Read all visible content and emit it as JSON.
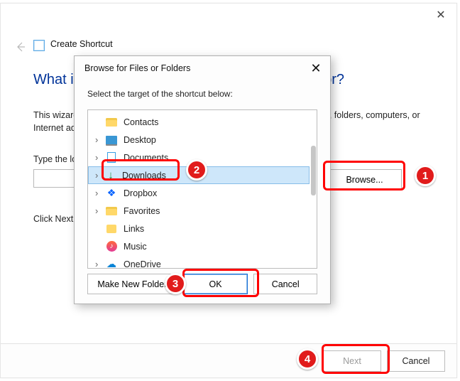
{
  "wizard": {
    "title": "Create Shortcut",
    "heading": "What item would you like to create a shortcut for?",
    "description": "This wizard helps you to create shortcuts to local or network programs, files, folders, computers, or Internet addresses.",
    "location_label": "Type the location of the item:",
    "browse_label": "Browse...",
    "continue_label": "Click Next to continue.",
    "next_label": "Next",
    "cancel_label": "Cancel"
  },
  "dialog": {
    "title": "Browse for Files or Folders",
    "instruction": "Select the target of the shortcut below:",
    "make_new_folder": "Make New Folder",
    "ok": "OK",
    "cancel": "Cancel",
    "items": [
      {
        "label": "Contacts",
        "icon": "folder",
        "expander": false,
        "selected": false
      },
      {
        "label": "Desktop",
        "icon": "desktop",
        "expander": true,
        "selected": false
      },
      {
        "label": "Documents",
        "icon": "document",
        "expander": true,
        "selected": false
      },
      {
        "label": "Downloads",
        "icon": "download",
        "expander": true,
        "selected": true
      },
      {
        "label": "Dropbox",
        "icon": "dropbox",
        "expander": true,
        "selected": false
      },
      {
        "label": "Favorites",
        "icon": "folder",
        "expander": true,
        "selected": false
      },
      {
        "label": "Links",
        "icon": "folder",
        "expander": false,
        "selected": false
      },
      {
        "label": "Music",
        "icon": "music",
        "expander": false,
        "selected": false
      },
      {
        "label": "OneDrive",
        "icon": "onedrive",
        "expander": true,
        "selected": false
      }
    ]
  },
  "annotations": {
    "b1": "1",
    "b2": "2",
    "b3": "3",
    "b4": "4"
  }
}
